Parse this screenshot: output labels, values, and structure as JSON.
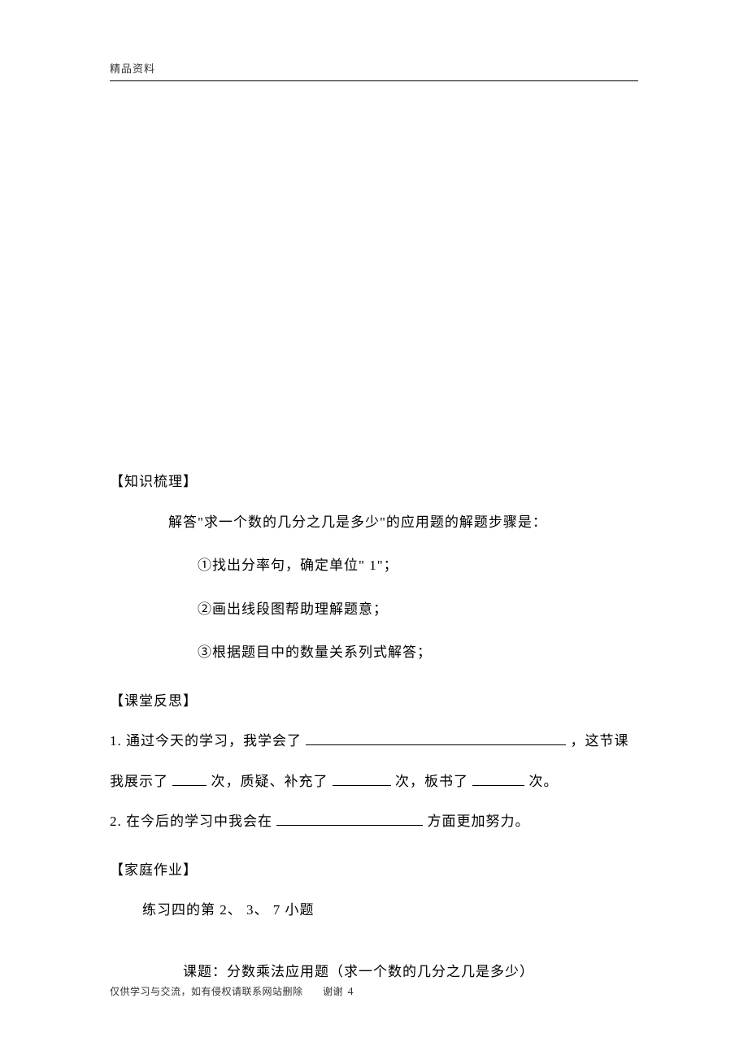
{
  "header": {
    "label": "精品资料"
  },
  "sections": {
    "knowledge": {
      "heading": "【知识梳理】",
      "intro": "解答\"求一个数的几分之几是多少\"的应用题的解题步骤是：",
      "steps": [
        "①找出分率句，确定单位\" 1\"；",
        "②画出线段图帮助理解题意；",
        "③根据题目中的数量关系列式解答；"
      ]
    },
    "reflection": {
      "heading": "【课堂反思】",
      "line1_a": "1. 通过今天的学习，我学会了 ",
      "line1_b": "，这节课",
      "line2_a": "我展示了 ",
      "line2_b": "次，质疑、补充了 ",
      "line2_c": "次，板书了 ",
      "line2_d": "次。",
      "line3_a": "2. 在今后的学习中我会在 ",
      "line3_b": "方面更加努力。"
    },
    "homework": {
      "heading": "【家庭作业】",
      "text": "练习四的第 2、 3、 7 小题"
    },
    "title": {
      "text": "课题：分数乘法应用题（求一个数的几分之几是多少）"
    }
  },
  "footer": {
    "notice": "仅供学习与交流，如有侵权请联系网站删除",
    "thanks": "谢谢",
    "page": "4"
  }
}
